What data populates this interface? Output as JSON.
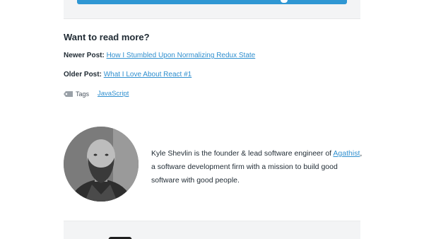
{
  "read_more": {
    "heading": "Want to read more?",
    "newer_label": "Newer Post:",
    "newer_title": "How I Stumbled Upon Normalizing Redux State",
    "older_label": "Older Post:",
    "older_title": "What I Love About React #1",
    "tags_label": "Tags",
    "tags": [
      "JavaScript"
    ]
  },
  "author": {
    "bio_prefix": "Kyle Shevlin is the founder & lead software engineer of ",
    "company": "Agathist",
    "bio_suffix": ", a software development firm with a mission to build good software with good people."
  },
  "colors": {
    "link": "#2f8fcf",
    "button": "#2f97d3",
    "card_bg": "#f3f4f5"
  }
}
